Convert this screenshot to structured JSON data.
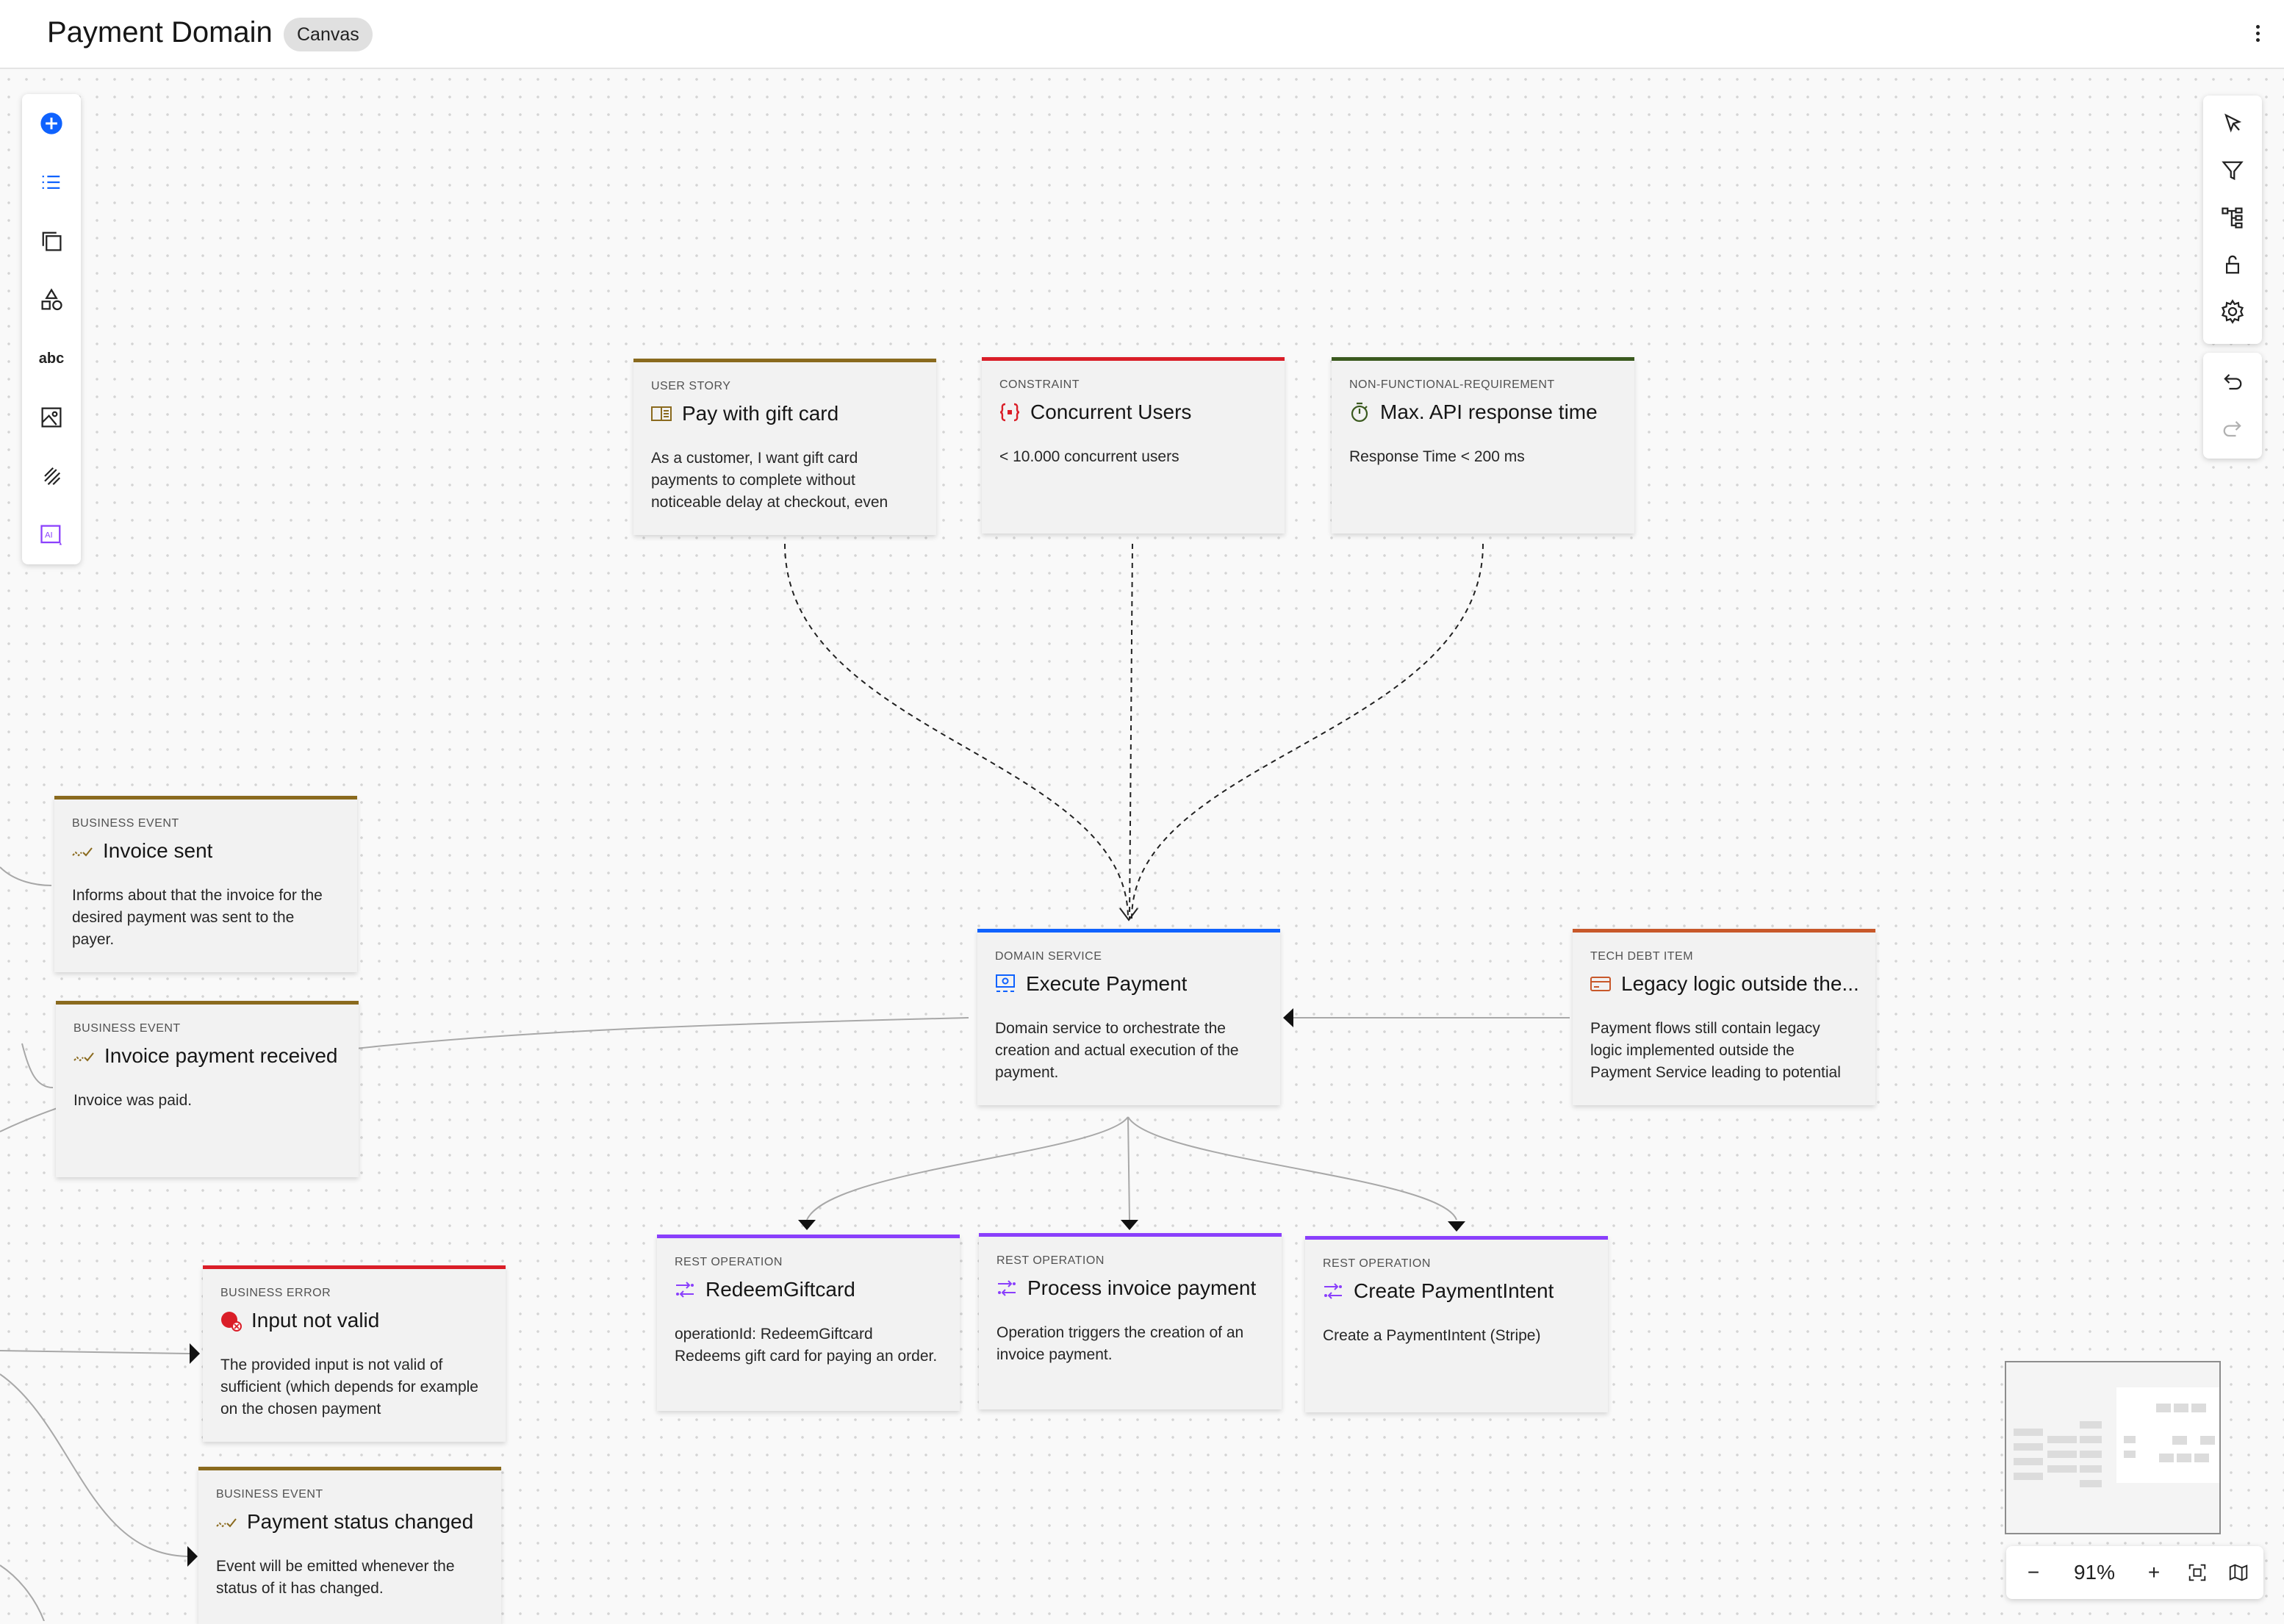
{
  "header": {
    "title": "Payment Domain",
    "badge": "Canvas"
  },
  "left_toolbar": [
    {
      "icon": "add-circle-icon"
    },
    {
      "icon": "list-icon"
    },
    {
      "icon": "copy-icon"
    },
    {
      "icon": "shapes-icon"
    },
    {
      "icon": "text-icon",
      "label": "abc"
    },
    {
      "icon": "image-icon"
    },
    {
      "icon": "pen-icon"
    },
    {
      "icon": "ai-icon"
    }
  ],
  "right_toolbar": [
    {
      "icon": "cursor-icon"
    },
    {
      "icon": "filter-icon"
    },
    {
      "icon": "tree-icon"
    },
    {
      "icon": "unlock-icon"
    },
    {
      "icon": "settings-icon"
    },
    {
      "icon": "undo-icon"
    },
    {
      "icon": "redo-icon"
    }
  ],
  "cards": {
    "user_story": {
      "type": "USER STORY",
      "title": "Pay with gift card",
      "desc": "As a customer, I want gift card payments to complete without noticeable delay at checkout, even",
      "color": "#8a6a1e"
    },
    "constraint": {
      "type": "CONSTRAINT",
      "title": "Concurrent Users",
      "desc": "< 10.000 concurrent users",
      "color": "#da1e28"
    },
    "nfr": {
      "type": "NON-FUNCTIONAL-REQUIREMENT",
      "title": "Max. API response time",
      "desc": "Response Time < 200 ms",
      "color": "#3b5a1f"
    },
    "invoice_sent": {
      "type": "BUSINESS EVENT",
      "title": "Invoice sent",
      "desc": "Informs about that the invoice for the desired payment was sent to the payer.",
      "color": "#8a6a1e"
    },
    "invoice_received": {
      "type": "BUSINESS EVENT",
      "title": "Invoice payment received",
      "desc": "Invoice was paid.",
      "color": "#8a6a1e"
    },
    "execute_payment": {
      "type": "DOMAIN SERVICE",
      "title": "Execute Payment",
      "desc": "Domain service to orchestrate the creation and actual execution of the payment.",
      "color": "#0f62fe"
    },
    "tech_debt": {
      "type": "TECH DEBT ITEM",
      "title": "Legacy logic outside the...",
      "desc": "Payment flows still contain legacy logic implemented outside the Payment Service leading to potential",
      "color": "#c8582a"
    },
    "redeem": {
      "type": "REST OPERATION",
      "title": "RedeemGiftcard",
      "desc": "operationId: RedeemGiftcard Redeems gift card for paying an order.",
      "color": "#8a3ffc"
    },
    "process_invoice": {
      "type": "REST OPERATION",
      "title": "Process invoice payment",
      "desc": "Operation triggers the creation of an invoice payment.",
      "color": "#8a3ffc"
    },
    "create_intent": {
      "type": "REST OPERATION",
      "title": "Create PaymentIntent",
      "desc": "Create a PaymentIntent (Stripe)",
      "color": "#8a3ffc"
    },
    "input_invalid": {
      "type": "BUSINESS ERROR",
      "title": "Input not valid",
      "desc": "The provided input is not valid of sufficient (which depends for example on the chosen payment",
      "color": "#da1e28"
    },
    "status_changed": {
      "type": "BUSINESS EVENT",
      "title": "Payment status changed",
      "desc": "Event will be emitted whenever the status of it has changed.",
      "color": "#8a6a1e"
    }
  },
  "zoom": {
    "minus": "−",
    "level": "91%",
    "plus": "+"
  }
}
